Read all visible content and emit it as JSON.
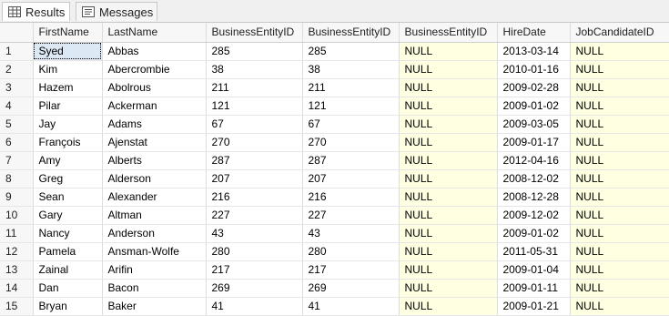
{
  "tabs": {
    "results": "Results",
    "messages": "Messages"
  },
  "columns": [
    "",
    "FirstName",
    "LastName",
    "BusinessEntityID",
    "BusinessEntityID",
    "BusinessEntityID",
    "HireDate",
    "JobCandidateID"
  ],
  "rows": [
    [
      "1",
      "Syed",
      "Abbas",
      "285",
      "285",
      "NULL",
      "2013-03-14",
      "NULL"
    ],
    [
      "2",
      "Kim",
      "Abercrombie",
      "38",
      "38",
      "NULL",
      "2010-01-16",
      "NULL"
    ],
    [
      "3",
      "Hazem",
      "Abolrous",
      "211",
      "211",
      "NULL",
      "2009-02-28",
      "NULL"
    ],
    [
      "4",
      "Pilar",
      "Ackerman",
      "121",
      "121",
      "NULL",
      "2009-01-02",
      "NULL"
    ],
    [
      "5",
      "Jay",
      "Adams",
      "67",
      "67",
      "NULL",
      "2009-03-05",
      "NULL"
    ],
    [
      "6",
      "François",
      "Ajenstat",
      "270",
      "270",
      "NULL",
      "2009-01-17",
      "NULL"
    ],
    [
      "7",
      "Amy",
      "Alberts",
      "287",
      "287",
      "NULL",
      "2012-04-16",
      "NULL"
    ],
    [
      "8",
      "Greg",
      "Alderson",
      "207",
      "207",
      "NULL",
      "2008-12-02",
      "NULL"
    ],
    [
      "9",
      "Sean",
      "Alexander",
      "216",
      "216",
      "NULL",
      "2008-12-28",
      "NULL"
    ],
    [
      "10",
      "Gary",
      "Altman",
      "227",
      "227",
      "NULL",
      "2009-12-02",
      "NULL"
    ],
    [
      "11",
      "Nancy",
      "Anderson",
      "43",
      "43",
      "NULL",
      "2009-01-02",
      "NULL"
    ],
    [
      "12",
      "Pamela",
      "Ansman-Wolfe",
      "280",
      "280",
      "NULL",
      "2011-05-31",
      "NULL"
    ],
    [
      "13",
      "Zainal",
      "Arifin",
      "217",
      "217",
      "NULL",
      "2009-01-04",
      "NULL"
    ],
    [
      "14",
      "Dan",
      "Bacon",
      "269",
      "269",
      "NULL",
      "2009-01-11",
      "NULL"
    ],
    [
      "15",
      "Bryan",
      "Baker",
      "41",
      "41",
      "NULL",
      "2009-01-21",
      "NULL"
    ]
  ],
  "colors": {
    "null_cell": "#ffffe1",
    "header_bg": "#f7f7f7",
    "selected_cell": "#dde8f5"
  },
  "icons": {
    "results": "grid-icon",
    "messages": "messages-icon"
  }
}
